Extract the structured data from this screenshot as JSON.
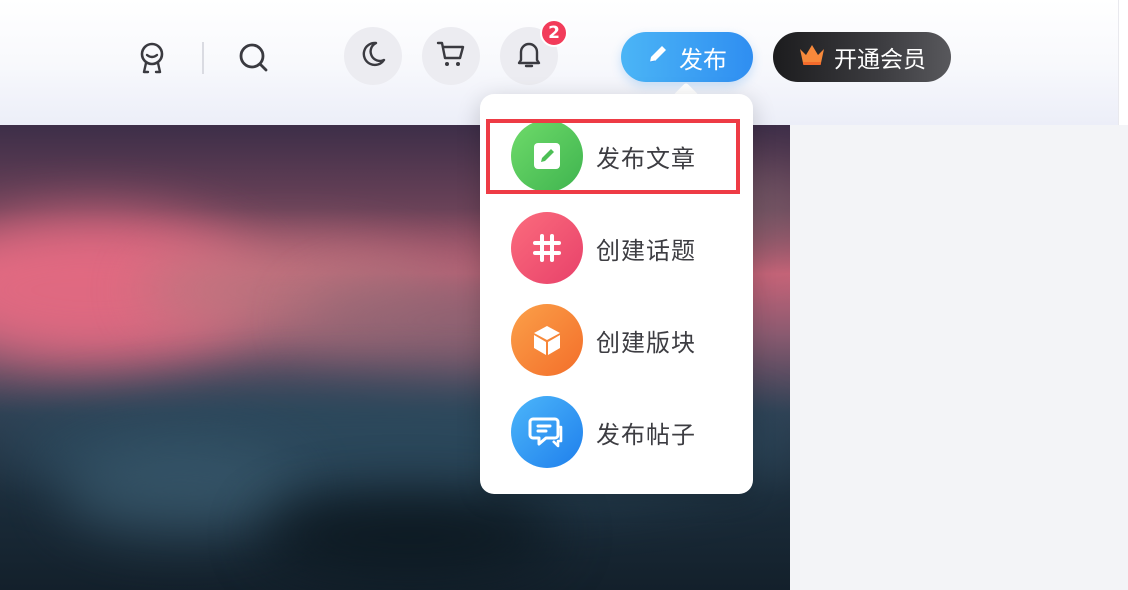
{
  "header": {
    "notification_count": "2",
    "publish_label": "发布",
    "vip_label": "开通会员"
  },
  "publish_menu": {
    "items": [
      {
        "label": "发布文章",
        "icon": "edit-icon",
        "color": "#52c65a",
        "highlighted": true
      },
      {
        "label": "创建话题",
        "icon": "hashtag-icon",
        "color": "#f0506e"
      },
      {
        "label": "创建版块",
        "icon": "cube-icon",
        "color": "#f78233"
      },
      {
        "label": "发布帖子",
        "icon": "chat-icon",
        "color": "#2a92ef"
      }
    ]
  },
  "colors": {
    "publish_button": "#3a9ff4",
    "vip_button": "#2a2a2c",
    "badge": "#f23c5a",
    "highlight_box": "#ee3b45"
  }
}
